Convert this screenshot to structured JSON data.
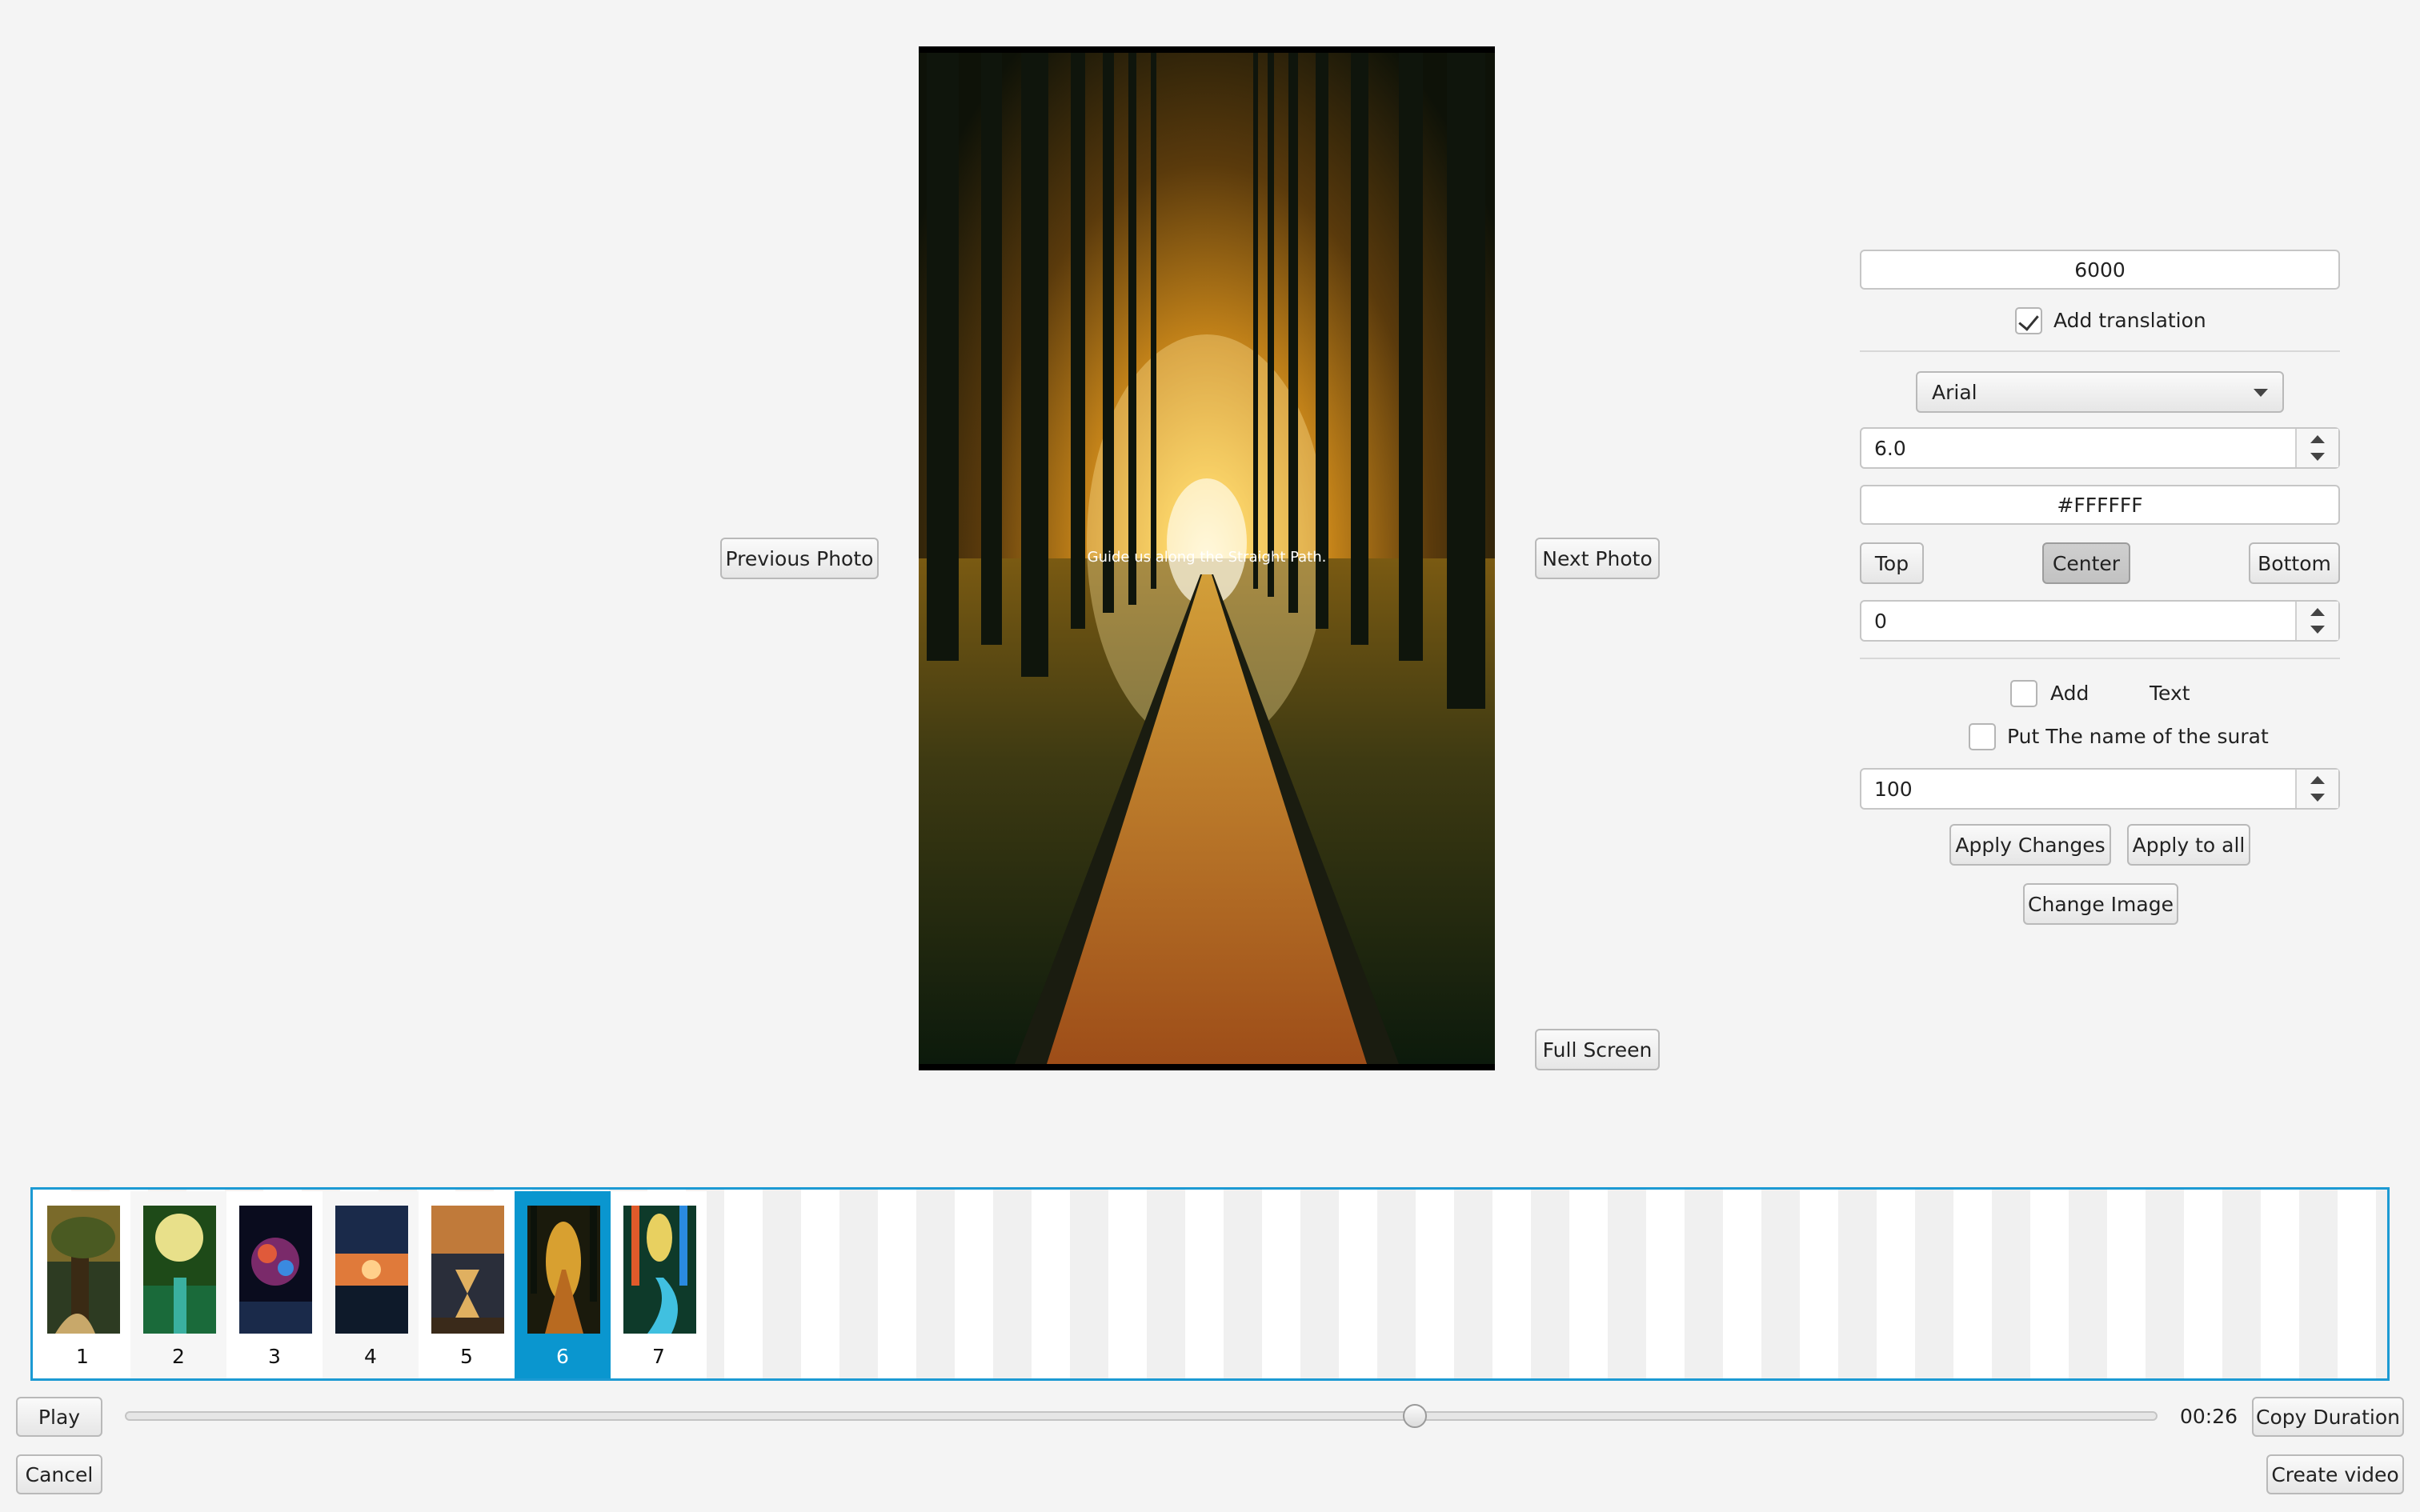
{
  "viewer": {
    "caption": "Guide us along the Straight Path.",
    "prev_label": "Previous Photo",
    "next_label": "Next Photo",
    "fullscreen_label": "Full Screen"
  },
  "settings": {
    "duration_value": "6000",
    "add_translation": {
      "label": "Add translation",
      "checked": true
    },
    "font_select": "Arial",
    "font_size": "6.0",
    "color_value": "#FFFFFF",
    "position": {
      "top": "Top",
      "center": "Center",
      "bottom": "Bottom",
      "selected": "Center"
    },
    "offset_value": "0",
    "add_text": {
      "label_add": "Add",
      "label_text": "Text",
      "checked": false
    },
    "surat_name": {
      "label": "Put The name of the surat",
      "checked": false
    },
    "opacity_value": "100",
    "apply_changes_label": "Apply Changes",
    "apply_all_label": "Apply to all",
    "change_image_label": "Change Image"
  },
  "filmstrip": {
    "selected_index": 5,
    "items": [
      {
        "number": "1"
      },
      {
        "number": "2"
      },
      {
        "number": "3"
      },
      {
        "number": "4"
      },
      {
        "number": "5"
      },
      {
        "number": "6"
      },
      {
        "number": "7"
      }
    ]
  },
  "playback": {
    "play_label": "Play",
    "time": "00:26",
    "copy_duration_label": "Copy Duration",
    "progress": 0.635
  },
  "footer": {
    "cancel_label": "Cancel",
    "create_label": "Create video"
  }
}
